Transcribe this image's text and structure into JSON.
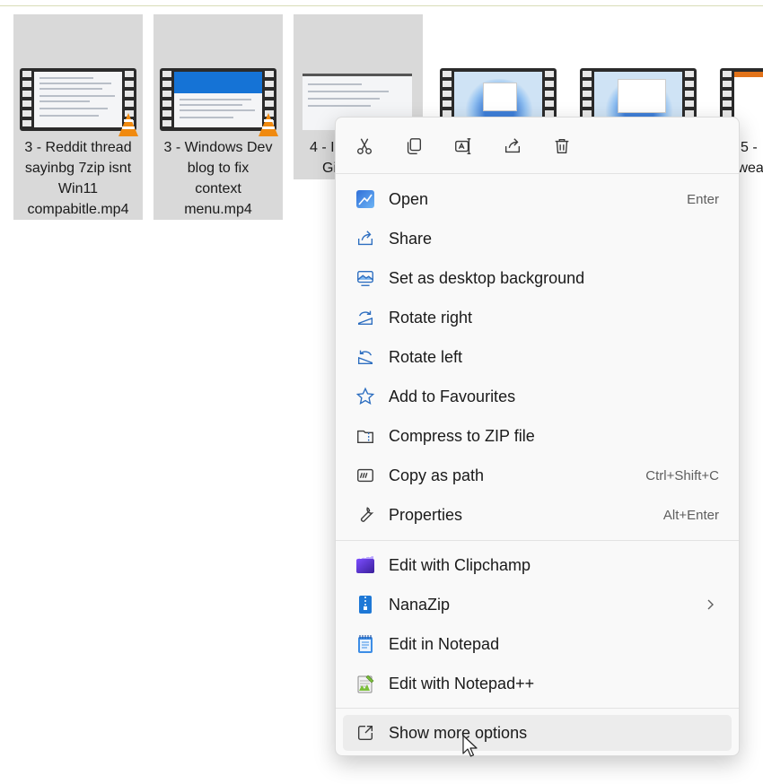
{
  "files": [
    {
      "label_lines": [
        "3 - Reddit thread",
        "sayinbg 7zip isnt",
        "Win11",
        "compabitle.mp4"
      ],
      "icon": "vlc-cone-icon"
    },
    {
      "label_lines": [
        "3 - Windows Dev",
        "blog to fix",
        "context",
        "menu.mp4"
      ],
      "icon": "vlc-cone-icon"
    },
    {
      "label_lines": [
        "4 - I",
        "Gi"
      ]
    },
    {
      "label_lines": []
    },
    {
      "label_lines": []
    },
    {
      "label_lines": [
        "5 -",
        "twea"
      ]
    }
  ],
  "quick_actions": [
    {
      "name": "cut",
      "icon": "scissors-icon"
    },
    {
      "name": "copy",
      "icon": "copy-icon"
    },
    {
      "name": "rename",
      "icon": "rename-icon"
    },
    {
      "name": "share",
      "icon": "share-icon"
    },
    {
      "name": "delete",
      "icon": "trash-icon"
    }
  ],
  "menu": {
    "items": [
      {
        "label": "Open",
        "shortcut": "Enter",
        "icon": "photos-app-icon"
      },
      {
        "label": "Share",
        "shortcut": "",
        "icon": "share-icon"
      },
      {
        "label": "Set as desktop background",
        "shortcut": "",
        "icon": "desktop-background-icon"
      },
      {
        "label": "Rotate right",
        "shortcut": "",
        "icon": "rotate-right-icon"
      },
      {
        "label": "Rotate left",
        "shortcut": "",
        "icon": "rotate-left-icon"
      },
      {
        "label": "Add to Favourites",
        "shortcut": "",
        "icon": "star-icon"
      },
      {
        "label": "Compress to ZIP file",
        "shortcut": "",
        "icon": "zip-folder-icon"
      },
      {
        "label": "Copy as path",
        "shortcut": "Ctrl+Shift+C",
        "icon": "copy-path-icon"
      },
      {
        "label": "Properties",
        "shortcut": "Alt+Enter",
        "icon": "wrench-icon"
      }
    ],
    "apps": [
      {
        "label": "Edit with Clipchamp",
        "icon": "clipchamp-icon"
      },
      {
        "label": "NanaZip",
        "icon": "nanazip-icon",
        "submenu": true
      },
      {
        "label": "Edit in Notepad",
        "icon": "notepad-icon"
      },
      {
        "label": "Edit with Notepad++",
        "icon": "notepad-plus-plus-icon"
      }
    ],
    "more": {
      "label": "Show more options",
      "icon": "show-more-options-icon"
    }
  },
  "colors": {
    "selection": "#d9d9d9",
    "menu_bg": "#f9f9f9",
    "accent": "#0067c0",
    "vlc_orange": "#f08a10"
  }
}
